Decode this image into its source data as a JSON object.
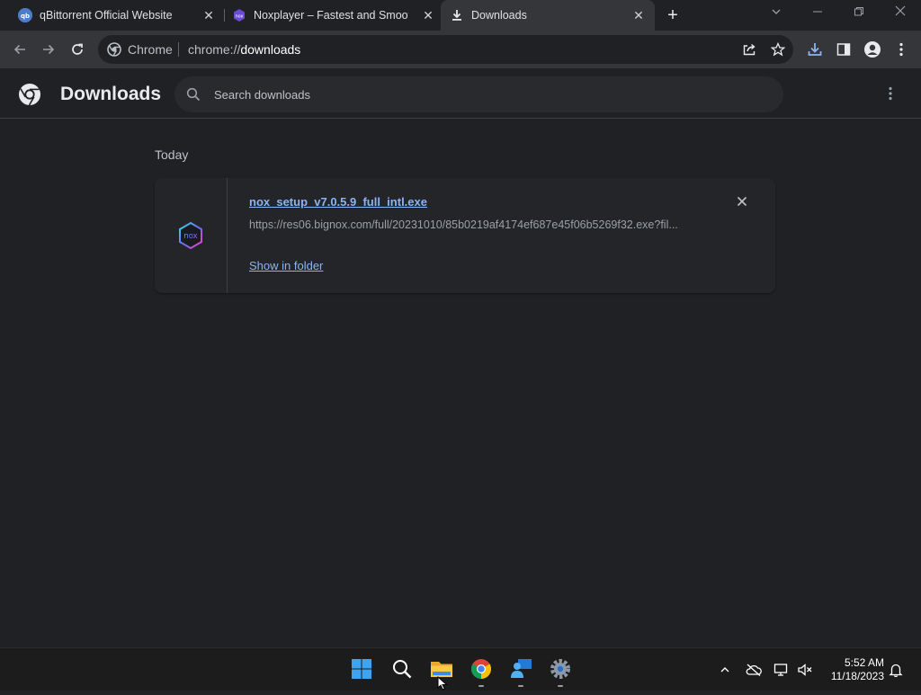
{
  "tabs": [
    {
      "title": "qBittorrent Official Website",
      "favicon": "qbittorrent-icon"
    },
    {
      "title": "Noxplayer – Fastest and Smoothest Android Emulator",
      "favicon": "noxplayer-icon"
    },
    {
      "title": "Downloads",
      "favicon": "download-icon",
      "active": true
    }
  ],
  "toolbar": {
    "site_chip": "Chrome",
    "url_scheme": "chrome://",
    "url_host": "downloads"
  },
  "page": {
    "title": "Downloads",
    "search_placeholder": "Search downloads",
    "section_date": "Today"
  },
  "downloads": [
    {
      "file_name": "nox_setup_v7.0.5.9_full_intl.exe",
      "url": "https://res06.bignox.com/full/20231010/85b0219af4174ef687e45f06b5269f32.exe?fil...",
      "action_label": "Show in folder",
      "icon": "nox-app-icon"
    }
  ],
  "taskbar": {
    "time": "5:52 AM",
    "date": "11/18/2023"
  },
  "colors": {
    "background": "#202124",
    "toolbar": "#35363a",
    "link": "#8ab4f8",
    "taskbar": "#1c1c1c"
  }
}
